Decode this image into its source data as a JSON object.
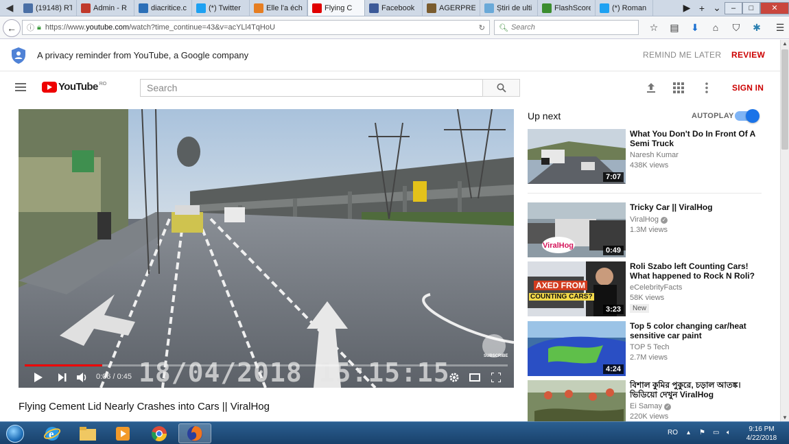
{
  "browser": {
    "tabs": [
      {
        "title": "(19148) RT",
        "favicon": "#4a6fa5"
      },
      {
        "title": "Admin - R",
        "favicon": "#c0392b"
      },
      {
        "title": "diacritice.c",
        "favicon": "#2c6fb7"
      },
      {
        "title": "(*) Twitter",
        "favicon": "#1da1f2"
      },
      {
        "title": "Elle l'a éch",
        "favicon": "#e67e22"
      },
      {
        "title": "Flying C",
        "favicon": "#e00000",
        "active": true
      },
      {
        "title": "Facebook",
        "favicon": "#3b5998"
      },
      {
        "title": "AGERPRES",
        "favicon": "#7a5c2e"
      },
      {
        "title": "Știri de ulti",
        "favicon": "#6aa9d8"
      },
      {
        "title": "FlashScore",
        "favicon": "#3c8d2f"
      },
      {
        "title": "(*) Roman",
        "favicon": "#1da1f2"
      }
    ],
    "url_prefix": "https://www.",
    "url_host": "youtube.com",
    "url_path": "/watch?time_continue=43&v=acYLl4TqHoU",
    "search_placeholder": "Search"
  },
  "privacy": {
    "message": "A privacy reminder from YouTube, a Google company",
    "remind_later": "REMIND ME LATER",
    "review": "REVIEW"
  },
  "header": {
    "logo_text": "YouTube",
    "country": "RO",
    "search_placeholder": "Search",
    "sign_in": "SIGN IN"
  },
  "player": {
    "overlay_timestamp": "18/04/2018  15:15:15",
    "current_time": "0:06",
    "duration": "0:45",
    "progress_fraction": 0.16,
    "watermark": "SUBSCRIBE"
  },
  "video": {
    "title": "Flying Cement Lid Nearly Crashes into Cars || ViralHog"
  },
  "sidebar": {
    "up_next": "Up next",
    "autoplay": "AUTOPLAY",
    "autoplay_on": true,
    "recommendations": [
      {
        "title": "What You Don't Do In Front Of A Semi Truck",
        "channel": "Naresh Kumar",
        "verified": false,
        "views": "438K views",
        "duration": "7:07",
        "badge": ""
      },
      {
        "title": "Tricky Car || ViralHog",
        "channel": "ViralHog",
        "verified": true,
        "views": "1.3M views",
        "duration": "0:49",
        "badge": ""
      },
      {
        "title": "Roli Szabo left Counting Cars! What happened to Rock N Roli?",
        "channel": "eCelebrityFacts",
        "verified": false,
        "views": "58K views",
        "duration": "3:23",
        "badge": "New"
      },
      {
        "title": "Top 5 color changing car/heat sensitive car paint",
        "channel": "TOP 5 Tech",
        "verified": false,
        "views": "2.7M views",
        "duration": "4:24",
        "badge": ""
      },
      {
        "title": "বিশাল কুমির পুকুরে, চড়াল আতঙ্ক। ভিডিয়ো দেখুন ViralHog",
        "channel": "Ei Samay",
        "verified": true,
        "views": "220K views",
        "duration": "",
        "badge": ""
      }
    ],
    "thumb_captions": [
      "ViralHog",
      "AXED FROM",
      "COUNTING CARS?"
    ]
  },
  "taskbar": {
    "language": "RO",
    "time": "9:16 PM",
    "date": "4/22/2018"
  }
}
